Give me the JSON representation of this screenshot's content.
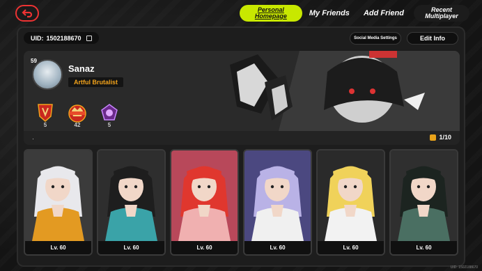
{
  "nav": {
    "back_icon": "back-arrow-icon",
    "tabs": [
      {
        "label": "Personal Homepage",
        "active": true
      },
      {
        "label": "My Friends",
        "active": false
      },
      {
        "label": "Add Friend",
        "active": false
      },
      {
        "label": "Recent Multiplayer",
        "active": false
      }
    ]
  },
  "profile": {
    "uid_label": "UID:",
    "uid_value": "1502188670",
    "social_button": "Social Media Settings",
    "edit_button": "Edit Info",
    "level": "59",
    "name": "Sanaz",
    "title": "Artful Brutalist",
    "medals": [
      {
        "name": "rank-medal",
        "value": "5"
      },
      {
        "name": "legend-medal",
        "value": "42"
      },
      {
        "name": "crystal-medal",
        "value": "5"
      }
    ],
    "footer_dot": "·",
    "count": "1/10"
  },
  "agents": [
    {
      "level": "Lv. 60",
      "hair": "#e8e8ec",
      "outfit": "#e39a22",
      "bg": "#3b3b3b"
    },
    {
      "level": "Lv. 60",
      "hair": "#1e1e1e",
      "outfit": "#3aa3a8",
      "bg": "#2e2e2e"
    },
    {
      "level": "Lv. 60",
      "hair": "#e0372e",
      "outfit": "#f0b0b0",
      "bg": "#b8485a"
    },
    {
      "level": "Lv. 60",
      "hair": "#b9b2e6",
      "outfit": "#f0f0f0",
      "bg": "#4b4880"
    },
    {
      "level": "Lv. 60",
      "hair": "#f0d25a",
      "outfit": "#f2f2f2",
      "bg": "#2a2a2a"
    },
    {
      "level": "Lv. 60",
      "hair": "#1c2420",
      "outfit": "#4a6f62",
      "bg": "#2f2f2f"
    }
  ],
  "footer_uid": "UID: 1502188670",
  "colors": {
    "accent": "#c8e800",
    "title": "#f2a31c",
    "back": "#e33333"
  }
}
